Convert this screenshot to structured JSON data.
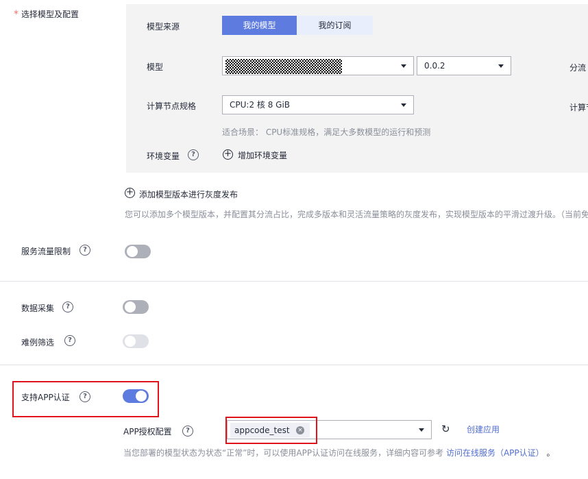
{
  "model_config": {
    "label": "选择模型及配置",
    "required_mark": "*",
    "source_label": "模型来源",
    "source_tabs": [
      "我的模型",
      "我的订阅"
    ],
    "model_label": "模型",
    "model_version": "0.0.2",
    "traffic_label": "分流",
    "compute_label": "计算节点规格",
    "compute_value": "CPU:2 核 8 GiB",
    "compute_right_label": "计算节",
    "compute_hint": "适合场景： CPU标准规格，满足大多数模型的运行和预测",
    "env_label": "环境变量",
    "env_add": "增加环境变量"
  },
  "gray_release": {
    "add_label": "添加模型版本进行灰度发布",
    "desc": "您可以添加多个模型版本，并配置其分流占比，完成多版本和灵活流量策略的灰度发布，实现模型版本的平滑过渡升级。（当前免"
  },
  "settings": {
    "traffic_limit": "服务流量限制",
    "data_collection": "数据采集",
    "hard_example": "难例筛选",
    "app_auth": "支持APP认证",
    "app_auth_config": "APP授权配置",
    "app_tag": "appcode_test",
    "create_app": "创建应用",
    "footer_text": "当您部署的模型状态为状态“正常”时，可以使用APP认证访问在线服务，详细内容可参考",
    "footer_link": "访问在线服务（APP认证）",
    "footer_end": "。"
  },
  "icons": {
    "help": "?",
    "plus": "+",
    "refresh": "↻",
    "tag_close": "×"
  }
}
